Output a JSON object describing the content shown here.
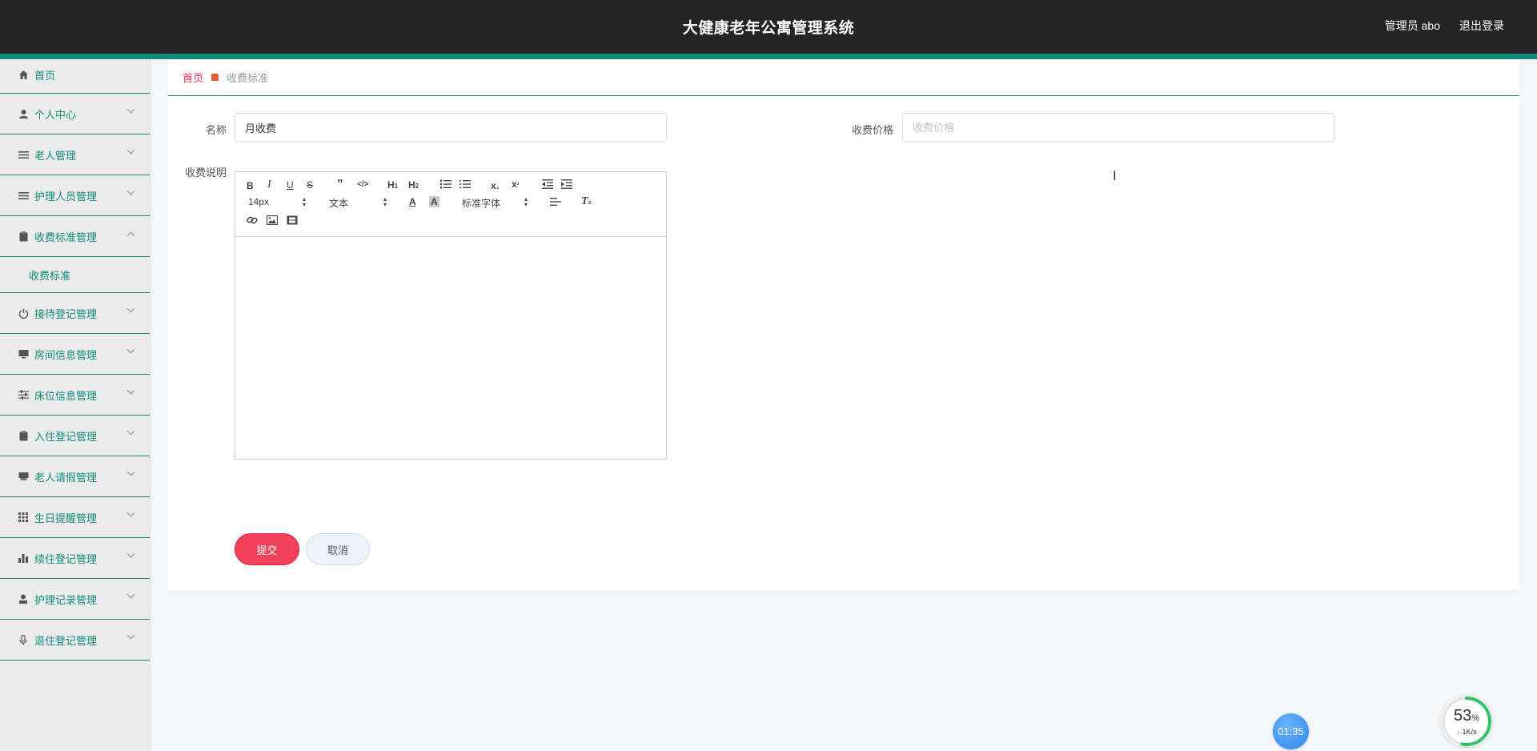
{
  "header": {
    "title": "大健康老年公寓管理系统",
    "user_label": "管理员 abo",
    "logout_label": "退出登录",
    "accent_color": "#0e8b7b"
  },
  "sidebar": {
    "items": [
      {
        "label": "首页",
        "icon": "home-icon"
      },
      {
        "label": "个人中心",
        "icon": "user-icon"
      },
      {
        "label": "老人管理",
        "icon": "list-icon"
      },
      {
        "label": "护理人员管理",
        "icon": "list-icon"
      },
      {
        "label": "收费标准管理",
        "icon": "clipboard-icon",
        "expanded": true,
        "children": [
          {
            "label": "收费标准"
          }
        ]
      },
      {
        "label": "接待登记管理",
        "icon": "power-icon"
      },
      {
        "label": "房间信息管理",
        "icon": "monitor-icon"
      },
      {
        "label": "床位信息管理",
        "icon": "sliders-icon"
      },
      {
        "label": "入住登记管理",
        "icon": "clipboard-icon"
      },
      {
        "label": "老人请假管理",
        "icon": "printer-icon"
      },
      {
        "label": "生日提醒管理",
        "icon": "grid-icon"
      },
      {
        "label": "续住登记管理",
        "icon": "bar-chart-icon"
      },
      {
        "label": "护理记录管理",
        "icon": "person-icon"
      },
      {
        "label": "退住登记管理",
        "icon": "mic-icon"
      }
    ]
  },
  "breadcrumb": {
    "home": "首页",
    "current": "收费标准"
  },
  "form": {
    "name_label": "名称",
    "name_value": "月收费",
    "price_label": "收费价格",
    "price_placeholder": "收费价格",
    "desc_label": "收费说明",
    "editor": {
      "font_size": "14px",
      "block_format": "文本",
      "font_family": "标准字体"
    },
    "submit_label": "提交",
    "cancel_label": "取消"
  },
  "widgets": {
    "timer": "01:35",
    "net_percent": "53",
    "net_percent_unit": "%",
    "net_speed": "1K/s"
  }
}
